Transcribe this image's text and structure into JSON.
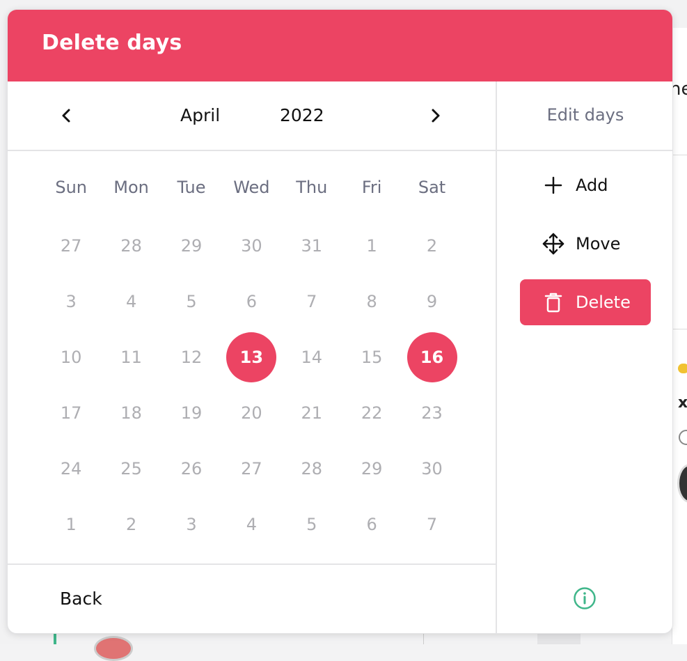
{
  "modal": {
    "title": "Delete days"
  },
  "calendar": {
    "month": "April",
    "year": "2022",
    "weekdays": [
      "Sun",
      "Mon",
      "Tue",
      "Wed",
      "Thu",
      "Fri",
      "Sat"
    ],
    "weeks": [
      [
        "27",
        "28",
        "29",
        "30",
        "31",
        "1",
        "2"
      ],
      [
        "3",
        "4",
        "5",
        "6",
        "7",
        "8",
        "9"
      ],
      [
        "10",
        "11",
        "12",
        "13",
        "14",
        "15",
        "16"
      ],
      [
        "17",
        "18",
        "19",
        "20",
        "21",
        "22",
        "23"
      ],
      [
        "24",
        "25",
        "26",
        "27",
        "28",
        "29",
        "30"
      ],
      [
        "1",
        "2",
        "3",
        "4",
        "5",
        "6",
        "7"
      ]
    ],
    "selected_days": [
      "13",
      "16"
    ],
    "prev_icon": "chevron-left-icon",
    "next_icon": "chevron-right-icon"
  },
  "footer": {
    "back_label": "Back",
    "info_icon": "info-icon"
  },
  "edit_panel": {
    "title": "Edit days",
    "actions": [
      {
        "label": "Add",
        "icon": "plus-icon",
        "active": false
      },
      {
        "label": "Move",
        "icon": "move-arrows-icon",
        "active": false
      },
      {
        "label": "Delete",
        "icon": "trash-icon",
        "active": true
      }
    ]
  },
  "colors": {
    "accent": "#ec4463",
    "info": "#3fb68a",
    "muted_text": "#6b6e80",
    "day_text": "#aeaeb2"
  }
}
